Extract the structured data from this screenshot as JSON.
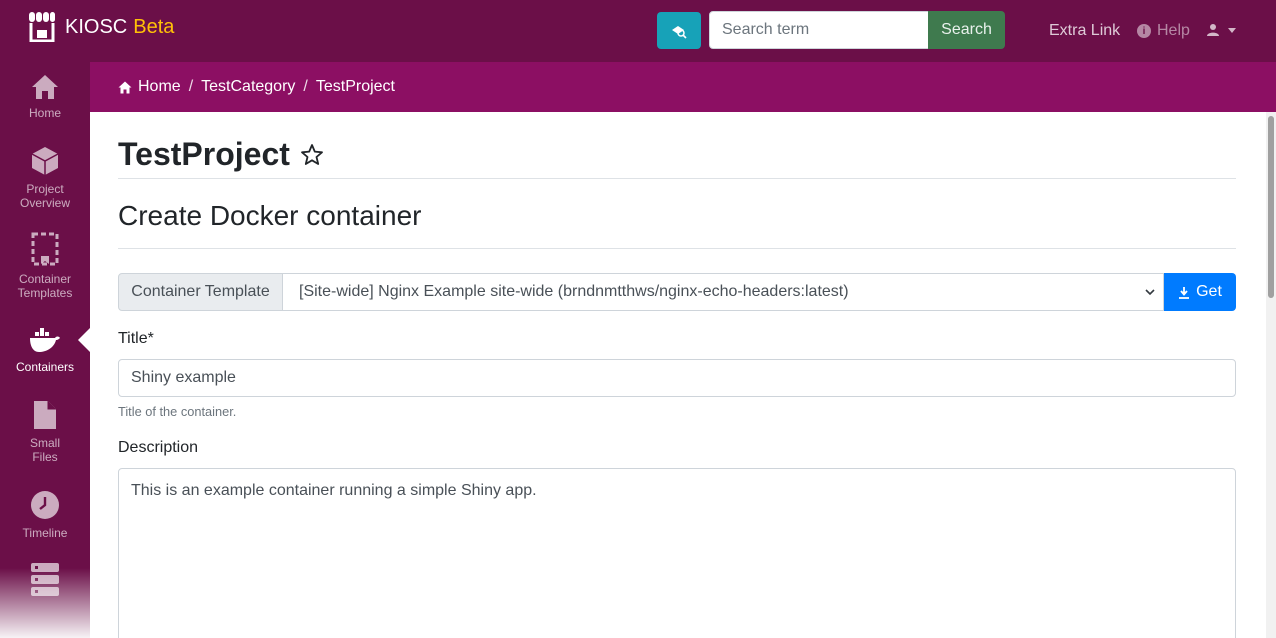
{
  "navbar": {
    "brand": "KIOSC",
    "brand_badge": "Beta",
    "search_placeholder": "Search term",
    "search_button": "Search",
    "extra_link": "Extra Link",
    "help": "Help",
    "colors": {
      "navbar": "#6b0f48",
      "accent": "#ffc107",
      "search_mode": "#17a2b8",
      "search_button": "#3f7a4e"
    }
  },
  "sidebar": {
    "items": [
      {
        "label": "Home",
        "icon": "home-icon"
      },
      {
        "label": "Project Overview",
        "icon": "cube-icon"
      },
      {
        "label": "Container Templates",
        "icon": "dashed-template-icon"
      },
      {
        "label": "Containers",
        "icon": "docker-icon",
        "active": true
      },
      {
        "label": "Small Files",
        "icon": "file-icon"
      },
      {
        "label": "Timeline",
        "icon": "clock-icon"
      },
      {
        "label": "",
        "icon": "server-icon"
      }
    ]
  },
  "breadcrumb": {
    "items": [
      "Home",
      "TestCategory",
      "TestProject"
    ],
    "separator": "/",
    "color": "#8c0f63"
  },
  "main": {
    "project_title": "TestProject",
    "section_title": "Create Docker container",
    "template": {
      "label": "Container Template",
      "selected": "[Site-wide] Nginx Example site-wide (brndnmtthws/nginx-echo-headers:latest)",
      "get_button": "Get"
    },
    "title_field": {
      "label": "Title*",
      "value": "Shiny example",
      "help": "Title of the container."
    },
    "description_field": {
      "label": "Description",
      "value": "This is an example container running a simple Shiny app."
    }
  }
}
